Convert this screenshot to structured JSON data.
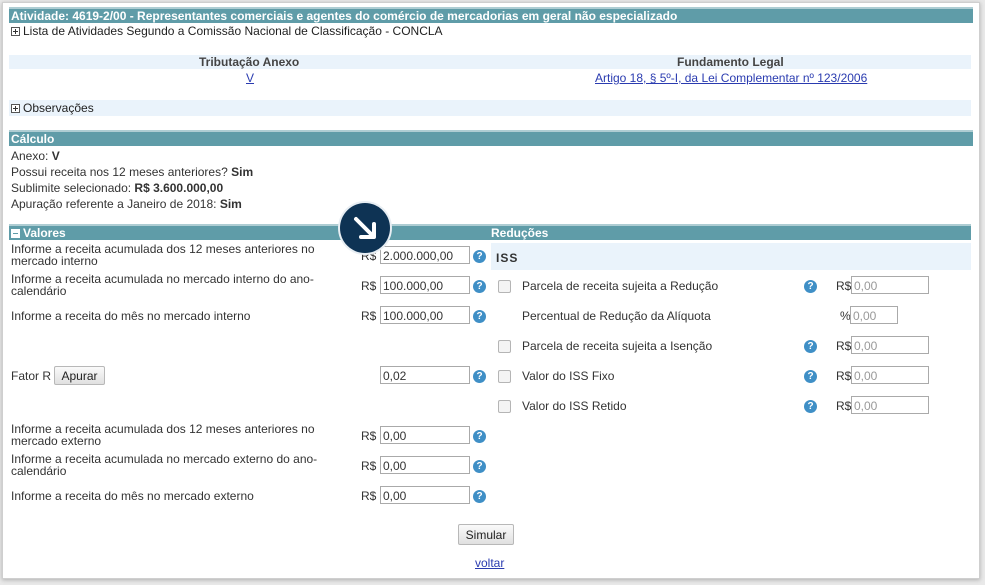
{
  "header": {
    "title": "Atividade: 4619-2/00 - Representantes comerciais e agentes do comércio de mercadorias em geral não especializado"
  },
  "concla": {
    "label": "Lista de Atividades Segundo a Comissão Nacional de Classificação - CONCLA"
  },
  "tributacao": {
    "col1_header": "Tributação Anexo",
    "col2_header": "Fundamento Legal",
    "anexo_link": "V",
    "fundamento_link": "Artigo 18, § 5º-I, da Lei Complementar nº 123/2006"
  },
  "observacoes": {
    "label": "Observações"
  },
  "calculo": {
    "title": "Cálculo",
    "lines": [
      {
        "label": "Anexo: ",
        "value": "V"
      },
      {
        "label": "Possui receita nos 12 meses anteriores? ",
        "value": "Sim"
      },
      {
        "label": "Sublimite selecionado: ",
        "value": "R$ 3.600.000,00"
      },
      {
        "label": "Apuração referente a Janeiro de 2018: ",
        "value": "Sim"
      }
    ]
  },
  "valores": {
    "title": "Valores",
    "currency": "R$",
    "rows": [
      {
        "label": "Informe a receita acumulada dos 12 meses anteriores no mercado interno",
        "value": "2.000.000,00"
      },
      {
        "label": "Informe a receita acumulada no mercado interno do ano-calendário",
        "value": "100.000,00"
      },
      {
        "label": "Informe a receita do mês no mercado interno",
        "value": "100.000,00"
      },
      {
        "label": "Informe a receita acumulada dos 12 meses anteriores no mercado externo",
        "value": "0,00"
      },
      {
        "label": "Informe a receita acumulada no mercado externo do ano-calendário",
        "value": "0,00"
      },
      {
        "label": "Informe a receita do mês no mercado externo",
        "value": "0,00"
      }
    ],
    "fator_r": {
      "label": "Fator R",
      "button": "Apurar",
      "value": "0,02"
    }
  },
  "reducoes": {
    "title": "Reduções",
    "iss_label": "ISS",
    "rows": [
      {
        "label": "Parcela de receita sujeita a Redução",
        "prefix": "R$",
        "value": "0,00"
      },
      {
        "label": "Percentual de Redução da Alíquota",
        "prefix": "%",
        "value": "0,00"
      },
      {
        "label": "Parcela de receita sujeita a Isenção",
        "prefix": "R$",
        "value": "0,00"
      },
      {
        "label": "Valor do ISS Fixo",
        "prefix": "R$",
        "value": "0,00"
      },
      {
        "label": "Valor do ISS Retido",
        "prefix": "R$",
        "value": "0,00"
      }
    ]
  },
  "actions": {
    "simular": "Simular",
    "voltar": "voltar"
  },
  "help_glyph": "?",
  "colors": {
    "header_bg": "#5f9ca8",
    "light_row": "#eaf3fb",
    "help_icon": "#3f8fc6",
    "badge": "#0e3354",
    "link": "#2a3bb0"
  }
}
